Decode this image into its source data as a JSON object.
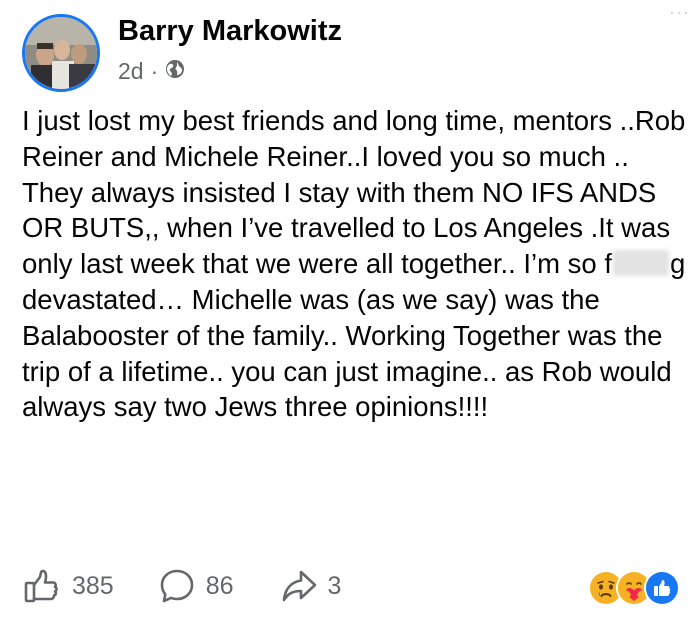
{
  "post": {
    "author": "Barry Markowitz",
    "age": "2d",
    "separator": "·",
    "audience_icon": "globe-icon",
    "more_icon": "more-icon",
    "body_before_redaction": "I just lost my best friends and long time, mentors ..Rob Reiner and Michele Reiner..I loved you so much .. They always insisted I stay with them NO IFS ANDS OR BUTS,, when I’ve travelled to Los Angeles .It was only last week that we were all together.. I’m so f",
    "body_after_redaction": "g devastated… Michelle was (as we say) was the Balabooster of the family.. Working Together was the trip of a lifetime.. you can just imagine.. as Rob would always say two Jews three opinions!!!!"
  },
  "actions": {
    "likes": "385",
    "comments": "86",
    "shares": "3"
  },
  "reactions": [
    "sad",
    "care",
    "like"
  ],
  "colors": {
    "accent": "#1877f2",
    "secondary_text": "#65676b",
    "primary_text": "#050505"
  }
}
